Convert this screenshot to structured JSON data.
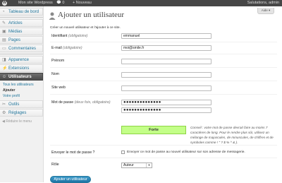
{
  "adminbar": {
    "wp_logo": "W",
    "site_name": "Mon site Wordpress",
    "comments_count": "0",
    "new_label": "Nouveau",
    "greeting": "Salutations, admin"
  },
  "sidebar": {
    "items": [
      {
        "label": "Tableau de bord",
        "icon": "dashboard-icon"
      },
      {
        "label": "Articles",
        "icon": "pin-icon"
      },
      {
        "label": "Médias",
        "icon": "media-icon"
      },
      {
        "label": "Pages",
        "icon": "page-icon"
      },
      {
        "label": "Commentaires",
        "icon": "comment-icon"
      },
      {
        "label": "Apparence",
        "icon": "appearance-icon"
      },
      {
        "label": "Extensions",
        "icon": "plugin-icon"
      },
      {
        "label": "Utilisateurs",
        "icon": "users-icon"
      },
      {
        "label": "Outils",
        "icon": "tools-icon"
      },
      {
        "label": "Réglages",
        "icon": "settings-icon"
      }
    ],
    "sub_items": [
      "Tous les utilisateurs",
      "Ajouter",
      "Votre profil"
    ],
    "collapse_label": "Réduire le menu"
  },
  "page": {
    "title": "Ajouter un utilisateur",
    "help_tab": "Aide",
    "intro": "Créer un nouvel utilisateur et l'ajouter à ce site."
  },
  "form": {
    "username_label": "Identifiant",
    "username_req": "(obligatoire)",
    "username_value": "emmanuel",
    "email_label": "E-mail",
    "email_req": "(obligatoire)",
    "email_value": "moi@smile.fr",
    "firstname_label": "Prénom",
    "firstname_value": "",
    "lastname_label": "Nom",
    "lastname_value": "",
    "website_label": "Site web",
    "website_value": "",
    "password_label": "Mot de passe",
    "password_req": "(deux fois, obligatoire)",
    "password_value": "●●●●●●●●●●●●●●",
    "password_confirm_value": "●●●●●●●●●●●●●●",
    "strength_label": "Forte",
    "strength_hint": "Conseil : votre mot de passe devrait faire au moins 7 caractères de long. Pour le rendre plus sûr, utilisez un mélange de majuscules, de minuscules, de chiffres et de symboles comme ! \" ? $ % ^ & ).",
    "send_password_label": "Envoyer le mot de passe ?",
    "send_password_text": "Envoyer ce mot de passe au nouvel utilisateur sur son adresse de messagerie.",
    "role_label": "Rôle",
    "role_value": "Auteur",
    "submit_label": "Ajouter un utilisateur"
  }
}
